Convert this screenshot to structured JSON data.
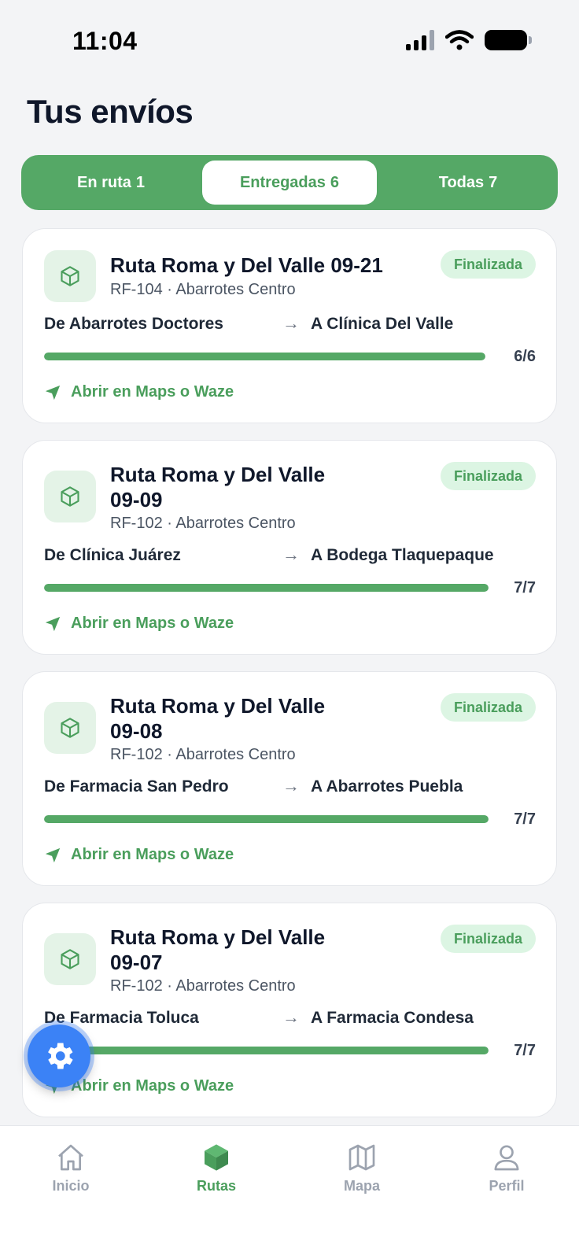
{
  "status_bar": {
    "time": "11:04"
  },
  "header": {
    "title": "Tus envíos"
  },
  "tabs": [
    {
      "label": "En ruta",
      "count": "1"
    },
    {
      "label": "Entregadas",
      "count": "6",
      "active": true
    },
    {
      "label": "Todas",
      "count": "7"
    }
  ],
  "cards": [
    {
      "title": "Ruta Roma y Del Valle 09-21",
      "status": "Finalizada",
      "subtitle": "RF-104 · Abarrotes Centro",
      "from": "De Abarrotes Doctores",
      "to": "A Clínica Del Valle",
      "progress_done": 6,
      "progress_total": 6,
      "progress_label": "6/6",
      "maps_link": "Abrir en Maps o Waze"
    },
    {
      "title": "Ruta Roma y Del Valle 09-09",
      "status": "Finalizada",
      "subtitle": "RF-102 · Abarrotes Centro",
      "from": "De Clínica Juárez",
      "to": "A Bodega Tlaquepaque",
      "progress_done": 7,
      "progress_total": 7,
      "progress_label": "7/7",
      "maps_link": "Abrir en Maps o Waze"
    },
    {
      "title": "Ruta Roma y Del Valle 09-08",
      "status": "Finalizada",
      "subtitle": "RF-102 · Abarrotes Centro",
      "from": "De Farmacia San Pedro",
      "to": "A Abarrotes Puebla",
      "progress_done": 7,
      "progress_total": 7,
      "progress_label": "7/7",
      "maps_link": "Abrir en Maps o Waze"
    },
    {
      "title": "Ruta Roma y Del Valle 09-07",
      "status": "Finalizada",
      "subtitle": "RF-102 · Abarrotes Centro",
      "from": "De Farmacia Toluca",
      "to": "A Farmacia Condesa",
      "progress_done": 7,
      "progress_total": 7,
      "progress_label": "7/7",
      "maps_link": "Abrir en Maps o Waze"
    }
  ],
  "fab": {
    "icon": "gear-icon"
  },
  "bottom_nav": [
    {
      "label": "Inicio",
      "icon": "home-icon"
    },
    {
      "label": "Rutas",
      "icon": "box-icon",
      "active": true
    },
    {
      "label": "Mapa",
      "icon": "map-icon"
    },
    {
      "label": "Perfil",
      "icon": "user-icon"
    }
  ],
  "colors": {
    "accent": "#55a866",
    "accent_text": "#4a9e5c",
    "badge_bg": "#dcf5e3",
    "icon_bg": "#e4f3e7",
    "fab": "#3b82f6",
    "background": "#f3f4f6"
  }
}
